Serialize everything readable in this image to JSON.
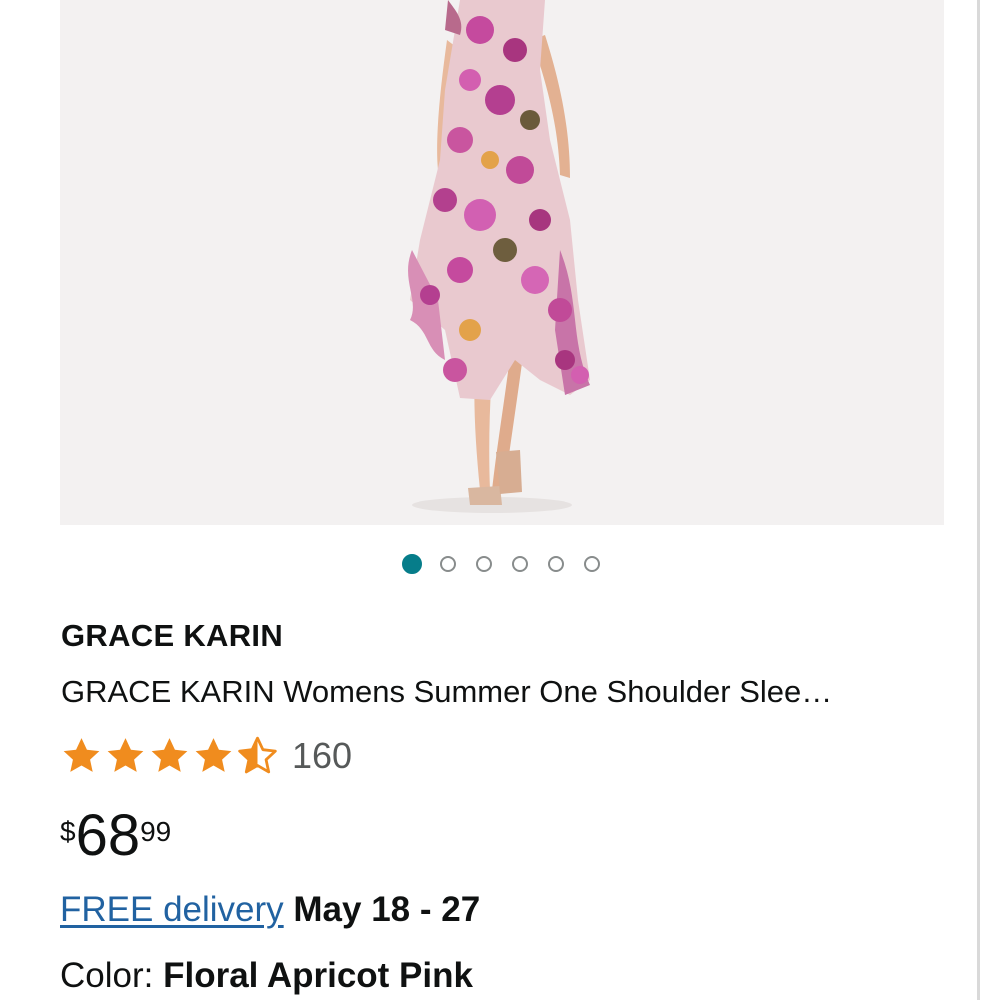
{
  "product": {
    "brand": "GRACE KARIN",
    "title": "GRACE KARIN Womens Summer One Shoulder Slee…",
    "rating": 4.5,
    "review_count": "160",
    "price": {
      "currency": "$",
      "whole": "68",
      "fraction": "99"
    },
    "delivery": {
      "link_text": "FREE delivery",
      "date": "May 18 - 27"
    },
    "color": {
      "label": "Color:",
      "value": "Floral Apricot Pink"
    }
  },
  "carousel": {
    "total": 6,
    "active_index": 0
  },
  "colors": {
    "star": "#f08c1e",
    "link": "#2162a1",
    "active_dot": "#067d8a"
  }
}
